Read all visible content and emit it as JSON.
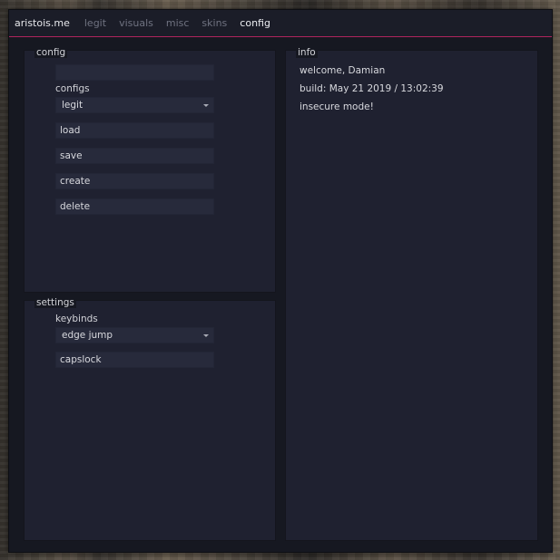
{
  "menubar": {
    "brand": "aristois.me",
    "tabs": [
      {
        "label": "legit",
        "active": false
      },
      {
        "label": "visuals",
        "active": false
      },
      {
        "label": "misc",
        "active": false
      },
      {
        "label": "skins",
        "active": false
      },
      {
        "label": "config",
        "active": true
      }
    ]
  },
  "config_panel": {
    "title": "config",
    "name_input": {
      "value": ""
    },
    "configs_label": "configs",
    "configs_select": {
      "value": "legit",
      "icon": "chevron-down-icon"
    },
    "buttons": {
      "load": "load",
      "save": "save",
      "create": "create",
      "delete": "delete"
    }
  },
  "settings_panel": {
    "title": "settings",
    "keybinds_label": "keybinds",
    "keybinds_select": {
      "value": "edge jump",
      "icon": "chevron-down-icon"
    },
    "key_field": "capslock"
  },
  "info_panel": {
    "title": "info",
    "welcome": "welcome, Damian",
    "build": "build: May 21 2019 / 13:02:39",
    "mode": "insecure mode!"
  },
  "colors": {
    "accent": "#b0245d",
    "window_bg": "#161821",
    "panel_bg": "#1f2130",
    "field_bg": "#272a3b"
  }
}
